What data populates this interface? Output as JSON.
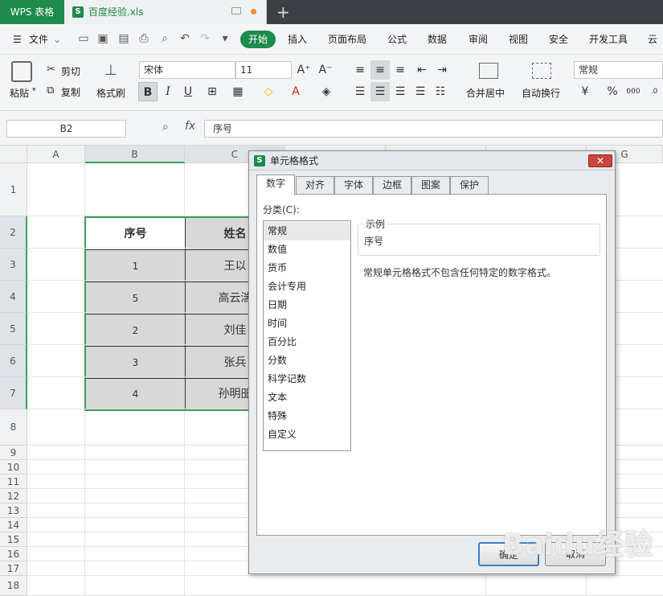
{
  "app": {
    "name": "WPS 表格",
    "file_tab": "百度经验.xls",
    "plus": "+"
  },
  "menu": {
    "file": "文件",
    "items": [
      "开始",
      "插入",
      "页面布局",
      "公式",
      "数据",
      "审阅",
      "视图",
      "安全",
      "开发工具",
      "云服"
    ]
  },
  "ribbon": {
    "paste": "粘贴",
    "cut": "剪切",
    "copy": "复制",
    "format_painter": "格式刷",
    "font_name": "宋体",
    "font_size": "11",
    "bold": "B",
    "italic": "I",
    "underline": "U",
    "font_color_glyph": "A",
    "grow_glyph": "A⁺",
    "shrink_glyph": "A⁻",
    "merge_center": "合并居中",
    "wrap_text": "自动换行",
    "number_format": "常规",
    "percent": "%"
  },
  "formula_bar": {
    "name_box": "B2",
    "fx": "fx",
    "content": "序号"
  },
  "grid": {
    "columns": [
      "A",
      "B",
      "C",
      "",
      "",
      "",
      "G"
    ],
    "rows": [
      "1",
      "2",
      "3",
      "4",
      "5",
      "6",
      "7",
      "8",
      "9",
      "10",
      "11",
      "12",
      "13",
      "14",
      "15",
      "16",
      "17",
      "18"
    ],
    "table": {
      "headers": [
        "序号",
        "姓名"
      ],
      "rows": [
        [
          "1",
          "王以"
        ],
        [
          "5",
          "高云湍"
        ],
        [
          "2",
          "刘佳"
        ],
        [
          "3",
          "张兵"
        ],
        [
          "4",
          "孙明昍"
        ]
      ]
    }
  },
  "dialog": {
    "title": "单元格格式",
    "close": "✕",
    "tabs": [
      "数字",
      "对齐",
      "字体",
      "边框",
      "图案",
      "保护"
    ],
    "category_label": "分类(C):",
    "categories": [
      "常规",
      "数值",
      "货币",
      "会计专用",
      "日期",
      "时间",
      "百分比",
      "分数",
      "科学记数",
      "文本",
      "特殊",
      "自定义"
    ],
    "sample_label": "示例",
    "sample_value": "序号",
    "description": "常规单元格格式不包含任何特定的数字格式。",
    "ok": "确定",
    "cancel": "取消"
  },
  "watermark": "Baidu经验",
  "colors": {
    "accent": "#1e8a4c",
    "titlebar": "#3c3f45",
    "selection_border": "#3f9e5a"
  }
}
